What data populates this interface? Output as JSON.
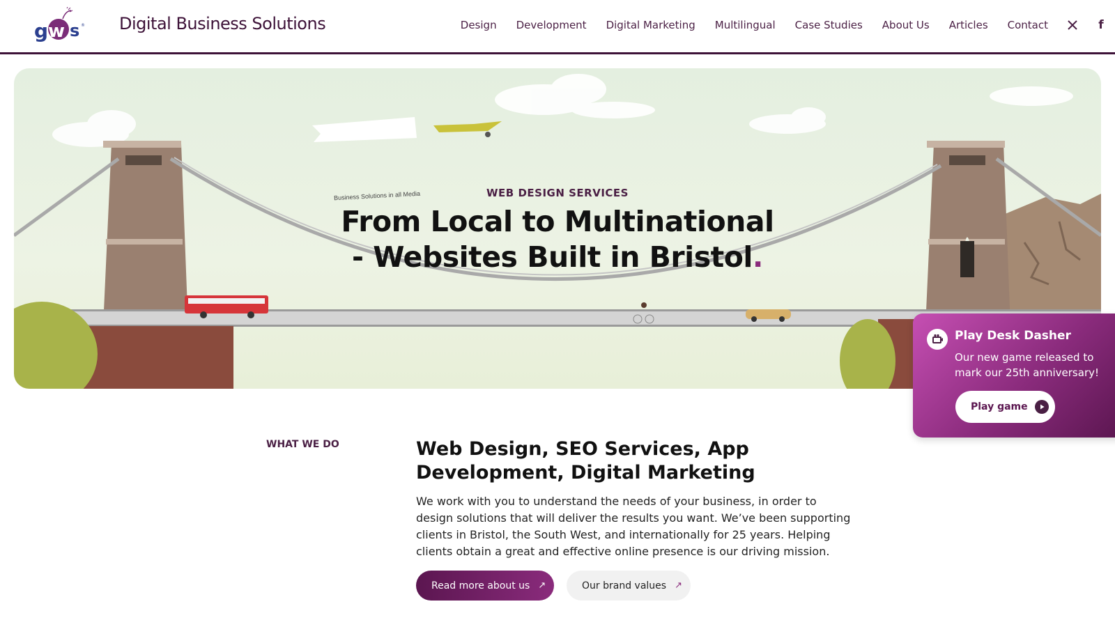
{
  "header": {
    "logo_text": "gws",
    "site_title": "Digital Business Solutions",
    "nav": [
      "Design",
      "Development",
      "Digital Marketing",
      "Multilingual",
      "Case Studies",
      "About Us",
      "Articles",
      "Contact"
    ],
    "social": {
      "x_label": "𝕏",
      "facebook_label": "f"
    }
  },
  "hero": {
    "banner_text": "Business Solutions in all Media",
    "eyebrow": "WEB DESIGN SERVICES",
    "title_line1": "From Local to Multinational",
    "title_line2": "- Websites Built in Bristol",
    "title_dot": "."
  },
  "game_popup": {
    "title": "Play Desk Dasher",
    "description": "Our new game released to mark our 25th anniversary!",
    "button_label": "Play game"
  },
  "what_we_do": {
    "label": "WHAT WE DO",
    "heading": "Web Design, SEO Services, App Development, Digital Marketing",
    "body": "We work with you to understand the needs of your business, in order to design solutions that will deliver the results you want. We’ve been supporting clients in Bristol, the South West, and internationally for 25 years. Helping clients obtain a great and effective online presence is our driving mission.",
    "primary_button": "Read more about us",
    "secondary_button": "Our brand values",
    "arrow": "↗"
  },
  "colors": {
    "brand": "#4a1f44",
    "accent": "#8a2b7c",
    "header_border": "#3d1238"
  }
}
